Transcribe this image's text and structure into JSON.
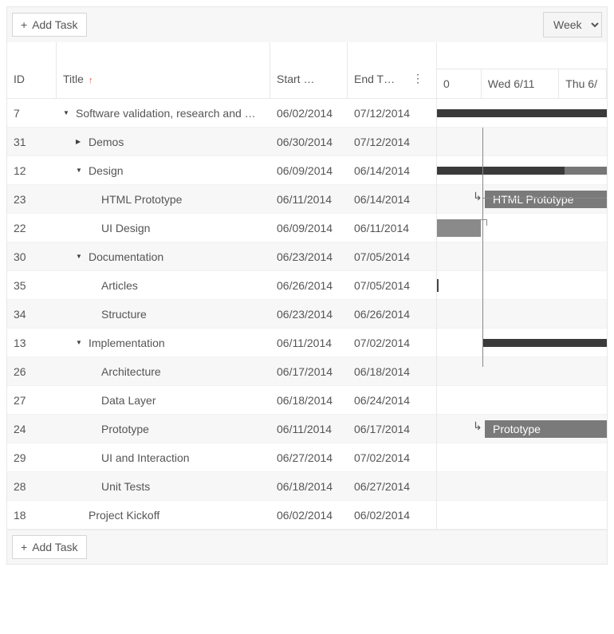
{
  "toolbar": {
    "add_task_label": "Add Task",
    "view_select": "Week"
  },
  "columns": {
    "id": "ID",
    "title": "Title",
    "start": "Start …",
    "end": "End T…"
  },
  "timeline_days": [
    "0",
    "Wed 6/11",
    "Thu 6/"
  ],
  "rows": [
    {
      "id": "7",
      "title": "Software validation, research and …",
      "start": "06/02/2014",
      "end": "07/12/2014",
      "indent": 0,
      "expander": "expanded"
    },
    {
      "id": "31",
      "title": "Demos",
      "start": "06/30/2014",
      "end": "07/12/2014",
      "indent": 1,
      "expander": "collapsed"
    },
    {
      "id": "12",
      "title": "Design",
      "start": "06/09/2014",
      "end": "06/14/2014",
      "indent": 1,
      "expander": "expanded"
    },
    {
      "id": "23",
      "title": "HTML Prototype",
      "start": "06/11/2014",
      "end": "06/14/2014",
      "indent": 2
    },
    {
      "id": "22",
      "title": "UI Design",
      "start": "06/09/2014",
      "end": "06/11/2014",
      "indent": 2
    },
    {
      "id": "30",
      "title": "Documentation",
      "start": "06/23/2014",
      "end": "07/05/2014",
      "indent": 1,
      "expander": "expanded"
    },
    {
      "id": "35",
      "title": "Articles",
      "start": "06/26/2014",
      "end": "07/05/2014",
      "indent": 2
    },
    {
      "id": "34",
      "title": "Structure",
      "start": "06/23/2014",
      "end": "06/26/2014",
      "indent": 2
    },
    {
      "id": "13",
      "title": "Implementation",
      "start": "06/11/2014",
      "end": "07/02/2014",
      "indent": 1,
      "expander": "expanded"
    },
    {
      "id": "26",
      "title": "Architecture",
      "start": "06/17/2014",
      "end": "06/18/2014",
      "indent": 2
    },
    {
      "id": "27",
      "title": "Data Layer",
      "start": "06/18/2014",
      "end": "06/24/2014",
      "indent": 2
    },
    {
      "id": "24",
      "title": "Prototype",
      "start": "06/11/2014",
      "end": "06/17/2014",
      "indent": 2
    },
    {
      "id": "29",
      "title": "UI and Interaction",
      "start": "06/27/2014",
      "end": "07/02/2014",
      "indent": 2
    },
    {
      "id": "28",
      "title": "Unit Tests",
      "start": "06/18/2014",
      "end": "06/27/2014",
      "indent": 2
    },
    {
      "id": "18",
      "title": "Project Kickoff",
      "start": "06/02/2014",
      "end": "06/02/2014",
      "indent": 1
    }
  ],
  "bar_labels": {
    "html_prototype": "HTML Prototype",
    "prototype": "Prototype"
  },
  "footer": {
    "add_task_label": "Add Task"
  }
}
